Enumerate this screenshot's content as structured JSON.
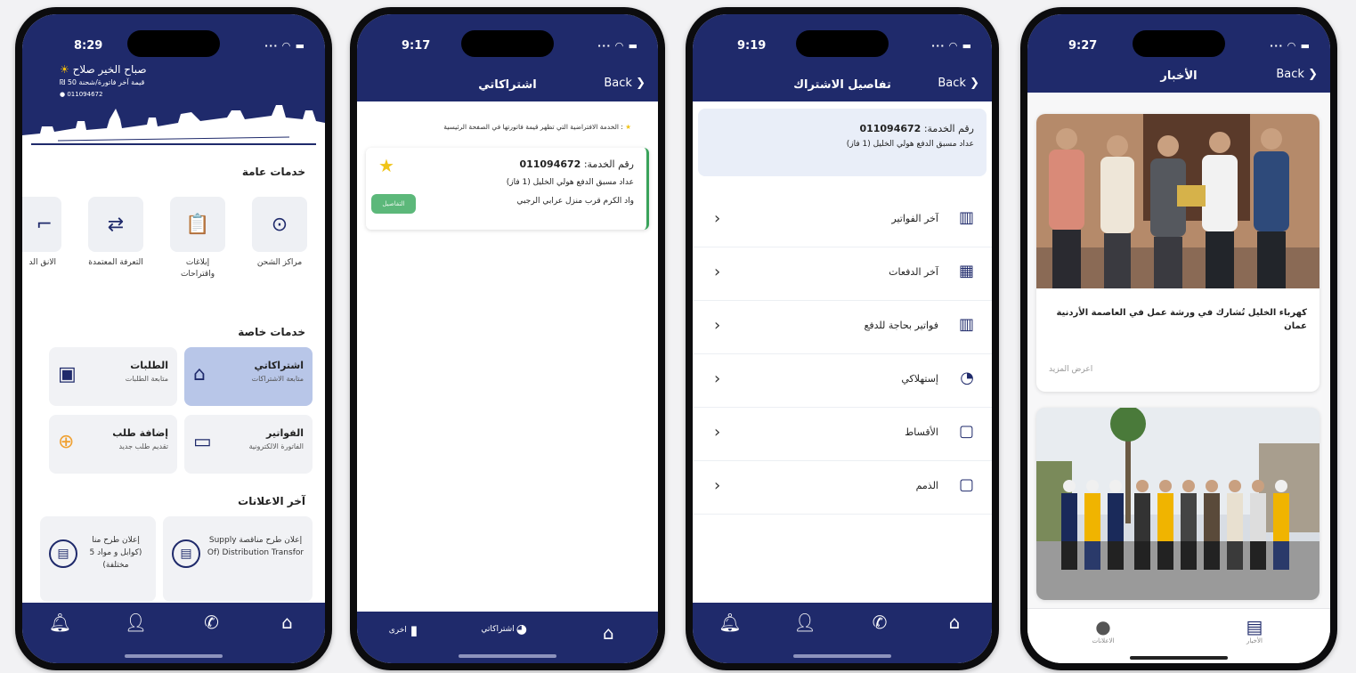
{
  "phone1": {
    "time": "8:29",
    "greeting": "صباح الخير صلاح",
    "last_bill": "قيمة آخر فاتورة/شحنة 50 ₪",
    "account": "011094672",
    "general_title": "خدمات عامة",
    "general_services": [
      {
        "label": "مراكز الشحن",
        "icon": "charging-location-icon"
      },
      {
        "label": "إبلاغات واقتراحات",
        "icon": "report-clipboard-icon"
      },
      {
        "label": "التعرفة المعتمدة",
        "icon": "tariff-exchange-icon"
      },
      {
        "label": "الانق الد",
        "icon": "partial-icon"
      }
    ],
    "private_title": "خدمات خاصة",
    "cards": [
      {
        "title": "اشتراكاتي",
        "subtitle": "متابعة الاشتراكات",
        "icon": "home-icon",
        "selected": true
      },
      {
        "title": "الطلبات",
        "subtitle": "متابعة الطلبات",
        "icon": "calendar-icon",
        "selected": false
      },
      {
        "title": "الفواتير",
        "subtitle": "الفاتورة الالكترونية",
        "icon": "money-bill-icon",
        "selected": false
      },
      {
        "title": "إضافة طلب",
        "subtitle": "تقديم طلب جديد",
        "icon": "add-circle-icon",
        "selected": false
      }
    ],
    "ann_title": "آخر الاعلانات",
    "announcements": [
      {
        "text": "إعلان طرح مناقصة Supply Of) Distribution Transfor"
      },
      {
        "text": "إعلان طرح منا (كوابل و مواد 5 مختلفة)"
      }
    ]
  },
  "phone2": {
    "time": "9:17",
    "title": "اشتراكاتي",
    "back": "Back",
    "note": ": الخدمة الافتراضية التي تظهر قيمة فاتورتها في الصفحة الرئيسية",
    "service_label": "رقم الخدمة:",
    "service_number": "011094672",
    "meter": "عداد مسبق الدفع هولي الخليل (1 فاز)",
    "address": "واد الكرم قرب منزل عرابي الرجبي",
    "details_btn": "التفاصيل",
    "tabs": [
      "اخرى",
      "اشتراكاتي"
    ]
  },
  "phone3": {
    "time": "9:19",
    "title": "تفاصيل الاشتراك",
    "back": "Back",
    "service_label": "رقم الخدمة:",
    "service_number": "011094672",
    "meter": "عداد مسبق الدفع هولي الخليل (1 فاز)",
    "items": [
      {
        "label": "آخر الفواتير",
        "icon": "invoice-icon"
      },
      {
        "label": "آخر الدفعات",
        "icon": "payments-icon"
      },
      {
        "label": "فواتير بحاجة للدفع",
        "icon": "unpaid-invoice-icon"
      },
      {
        "label": "إستهلاكي",
        "icon": "consumption-chart-icon"
      },
      {
        "label": "الأقساط",
        "icon": "installments-wallet-icon"
      },
      {
        "label": "الذمم",
        "icon": "debts-wallet-icon"
      }
    ]
  },
  "phone4": {
    "time": "9:27",
    "title": "الأخبار",
    "back": "Back",
    "headline": "كهرباء الخليل تُشارك في ورشة عمل في العاصمة الأردنية عمان",
    "more": "اعرض المزيد",
    "tabs": [
      "الأخبار",
      "الاعلانات"
    ]
  }
}
